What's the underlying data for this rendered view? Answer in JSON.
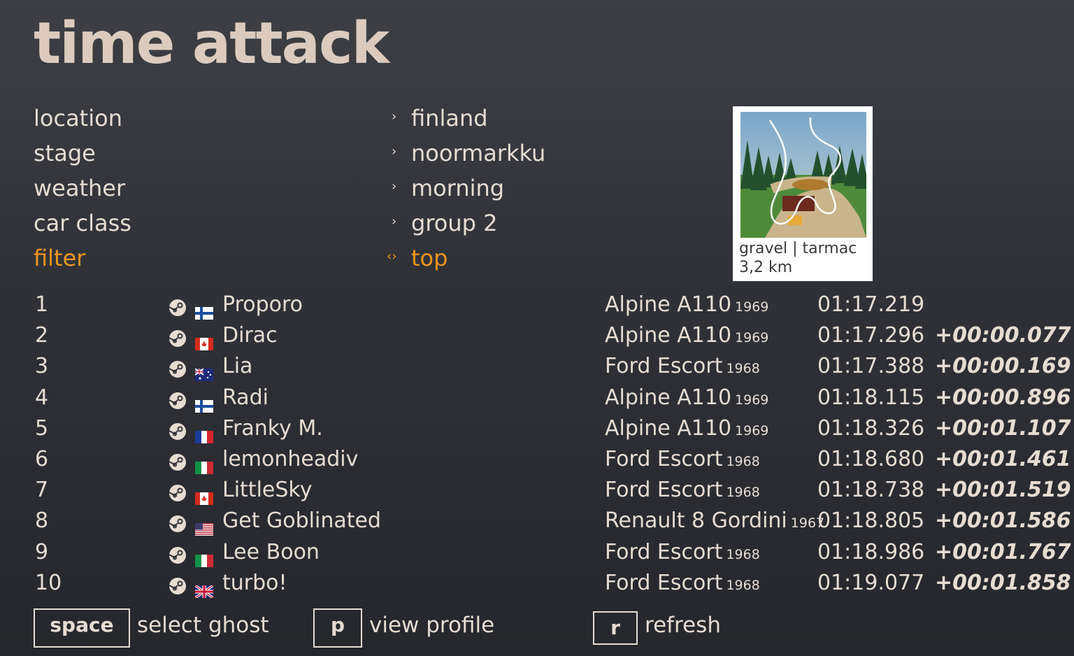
{
  "title": "time attack",
  "menu": [
    {
      "label": "location",
      "value": "finland",
      "arrow": "›"
    },
    {
      "label": "stage",
      "value": "noormarkku",
      "arrow": "›"
    },
    {
      "label": "weather",
      "value": "morning",
      "arrow": "›"
    },
    {
      "label": "car class",
      "value": "group 2",
      "arrow": "›"
    },
    {
      "label": "filter",
      "value": "top",
      "arrow": "‹›"
    }
  ],
  "stage_info": {
    "surface": "gravel | tarmac",
    "length": "3,2 km"
  },
  "leaderboard": [
    {
      "rank": "1",
      "flag": "fi",
      "name": "Proporo",
      "car": "Alpine A110",
      "year": "1969",
      "time": "01:17.219",
      "gap": ""
    },
    {
      "rank": "2",
      "flag": "ca",
      "name": "Dirac",
      "car": "Alpine A110",
      "year": "1969",
      "time": "01:17.296",
      "gap": "+00:00.077"
    },
    {
      "rank": "3",
      "flag": "au",
      "name": "Lia",
      "car": "Ford Escort",
      "year": "1968",
      "time": "01:17.388",
      "gap": "+00:00.169"
    },
    {
      "rank": "4",
      "flag": "fi",
      "name": "Radi",
      "car": "Alpine A110",
      "year": "1969",
      "time": "01:18.115",
      "gap": "+00:00.896"
    },
    {
      "rank": "5",
      "flag": "fr",
      "name": "Franky M.",
      "car": "Alpine A110",
      "year": "1969",
      "time": "01:18.326",
      "gap": "+00:01.107"
    },
    {
      "rank": "6",
      "flag": "it",
      "name": "lemonheadiv",
      "car": "Ford Escort",
      "year": "1968",
      "time": "01:18.680",
      "gap": "+00:01.461"
    },
    {
      "rank": "7",
      "flag": "ca",
      "name": "LittleSky",
      "car": "Ford Escort",
      "year": "1968",
      "time": "01:18.738",
      "gap": "+00:01.519"
    },
    {
      "rank": "8",
      "flag": "us",
      "name": "Get Goblinated",
      "car": "Renault 8 Gordini",
      "year": "1967",
      "time": "01:18.805",
      "gap": "+00:01.586"
    },
    {
      "rank": "9",
      "flag": "it",
      "name": "Lee Boon",
      "car": "Ford Escort",
      "year": "1968",
      "time": "01:18.986",
      "gap": "+00:01.767"
    },
    {
      "rank": "10",
      "flag": "gb",
      "name": "turbo!",
      "car": "Ford Escort",
      "year": "1968",
      "time": "01:19.077",
      "gap": "+00:01.858"
    }
  ],
  "footer": {
    "space_key": "space",
    "space_action": "select ghost",
    "p_key": "p",
    "p_action": "view profile",
    "r_key": "r",
    "r_action": "refresh"
  },
  "colors": {
    "accent": "#f0951d",
    "text": "#e6dcd2",
    "title": "#dccbbd"
  }
}
